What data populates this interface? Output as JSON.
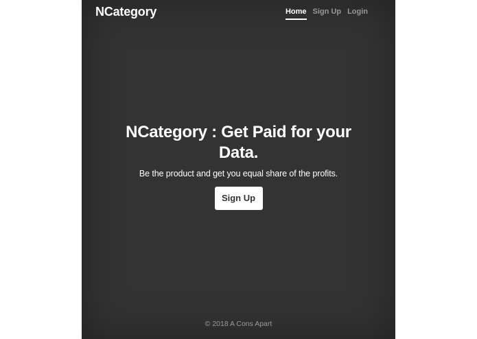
{
  "brand": {
    "name": "NCategory"
  },
  "nav": {
    "items": [
      {
        "label": "Home",
        "active": true
      },
      {
        "label": "Sign Up",
        "active": false
      },
      {
        "label": "Login",
        "active": false
      }
    ]
  },
  "hero": {
    "title": "NCategory : Get Paid for your Data.",
    "lead": "Be the product and get you equal share of the profits.",
    "button_label": "Sign Up"
  },
  "footer": {
    "text": "© 2018 A Cons Apart"
  },
  "colors": {
    "background": "#333333",
    "text": "#ffffff",
    "button_bg": "#ffffff",
    "button_text": "#333333"
  }
}
